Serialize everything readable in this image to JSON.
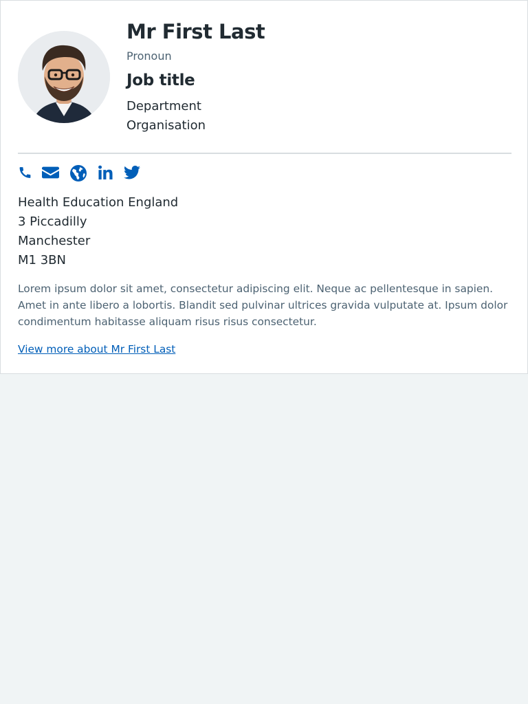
{
  "profile": {
    "name": "Mr First Last",
    "pronoun": "Pronoun",
    "job_title": "Job title",
    "department": "Department",
    "organisation": "Organisation"
  },
  "contact_icons": [
    "phone-icon",
    "email-icon",
    "globe-icon",
    "linkedin-icon",
    "twitter-icon"
  ],
  "address": {
    "line1": "Health Education England",
    "line2": "3 Piccadilly",
    "line3": "Manchester",
    "postcode": "M1 3BN"
  },
  "bio": "Lorem ipsum dolor sit amet, consectetur adipiscing elit. Neque ac pellentesque in sapien. Amet in ante libero a lobortis. Blandit sed pulvinar ultrices gravida vulputate at. Ipsum dolor condimentum habitasse aliquam risus risus consectetur.",
  "link": {
    "label": "View more about Mr First Last"
  },
  "colors": {
    "accent": "#005eb8",
    "text": "#212b32",
    "secondary_text": "#4c6272",
    "page_bg": "#f0f4f5",
    "divider": "#d8dde0"
  }
}
